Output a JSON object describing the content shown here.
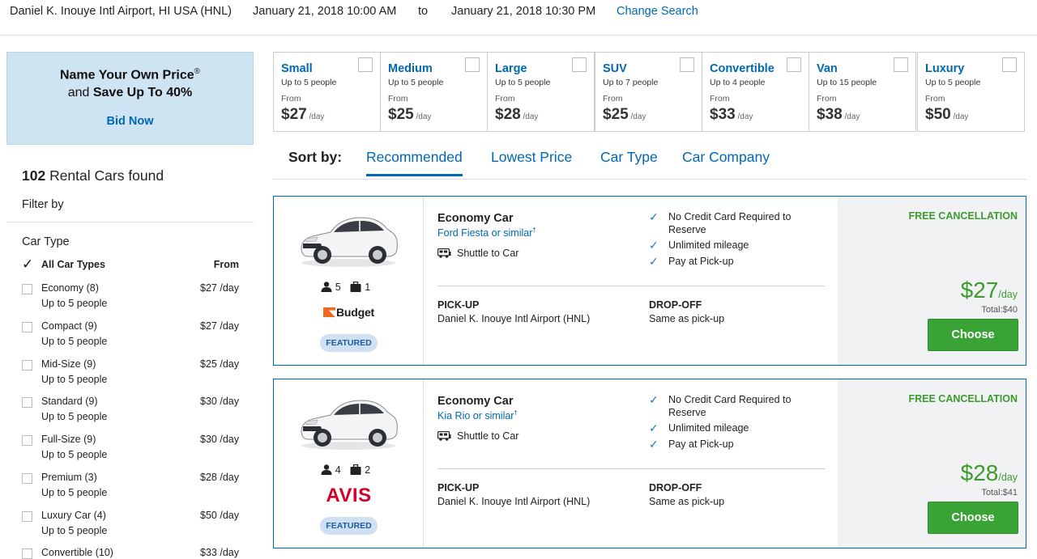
{
  "search": {
    "location": "Daniel K. Inouye Intl Airport, HI USA (HNL)",
    "pickup_datetime": "January 21, 2018 10:00 AM",
    "to_label": "to",
    "dropoff_datetime": "January 21, 2018 10:30 PM",
    "change_label": "Change Search"
  },
  "promo": {
    "line1": "Name Your Own Price",
    "reg": "®",
    "line2_prefix": "and ",
    "line2_bold": "Save Up To 40%",
    "button": "Bid Now"
  },
  "results_summary": {
    "count": "102",
    "label": " Rental Cars found",
    "filter_by": "Filter by"
  },
  "filters": {
    "title": "Car Type",
    "all_label": "All Car Types",
    "from_label": "From",
    "items": [
      {
        "name": "Economy (8)",
        "sub": "Up to 5 people",
        "price": "$27 /day"
      },
      {
        "name": "Compact (9)",
        "sub": "Up to 5 people",
        "price": "$27 /day"
      },
      {
        "name": "Mid-Size (9)",
        "sub": "Up to 5 people",
        "price": "$25 /day"
      },
      {
        "name": "Standard (9)",
        "sub": "Up to 5 people",
        "price": "$30 /day"
      },
      {
        "name": "Full-Size (9)",
        "sub": "Up to 5 people",
        "price": "$30 /day"
      },
      {
        "name": "Premium (3)",
        "sub": "Up to 5 people",
        "price": "$28 /day"
      },
      {
        "name": "Luxury Car (4)",
        "sub": "Up to 5 people",
        "price": "$50 /day"
      },
      {
        "name": "Convertible (10)",
        "sub": "",
        "price": "$33 /day"
      }
    ]
  },
  "car_types": [
    {
      "name": "Small",
      "sub": "Up to 5 people",
      "from": "From",
      "price": "$27",
      "per": " /day"
    },
    {
      "name": "Medium",
      "sub": "Up to 5 people",
      "from": "From",
      "price": "$25",
      "per": " /day"
    },
    {
      "name": "Large",
      "sub": "Up to 5 people",
      "from": "From",
      "price": "$28",
      "per": " /day"
    },
    {
      "name": "SUV",
      "sub": "Up to 7 people",
      "from": "From",
      "price": "$25",
      "per": " /day"
    },
    {
      "name": "Convertible",
      "sub": "Up to 4 people",
      "from": "From",
      "price": "$33",
      "per": " /day"
    },
    {
      "name": "Van",
      "sub": "Up to 15 people",
      "from": "From",
      "price": "$38",
      "per": " /day"
    },
    {
      "name": "Luxury",
      "sub": "Up to 5 people",
      "from": "From",
      "price": "$50",
      "per": " /day"
    }
  ],
  "sort": {
    "label": "Sort by:",
    "tabs": [
      "Recommended",
      "Lowest Price",
      "Car Type",
      "Car Company"
    ]
  },
  "results": [
    {
      "car_type": "Economy Car",
      "model": "Ford Fiesta or similar",
      "dagger": "†",
      "shuttle": "Shuttle to Car",
      "passengers": "5",
      "bags": "1",
      "company": "Budget",
      "badge": "FEATURED",
      "features": [
        "No Credit Card Required to Reserve",
        "Unlimited mileage",
        "Pay at Pick-up"
      ],
      "pickup_label": "PICK-UP",
      "pickup_value": "Daniel K. Inouye Intl Airport (HNL)",
      "dropoff_label": "DROP-OFF",
      "dropoff_value": "Same as pick-up",
      "cancellation": "FREE CANCELLATION",
      "price": "$27",
      "per": "/day",
      "total": "Total:$40",
      "choose": "Choose"
    },
    {
      "car_type": "Economy Car",
      "model": "Kia Rio or similar",
      "dagger": "†",
      "shuttle": "Shuttle to Car",
      "passengers": "4",
      "bags": "2",
      "company": "AVIS",
      "badge": "FEATURED",
      "features": [
        "No Credit Card Required to Reserve",
        "Unlimited mileage",
        "Pay at Pick-up"
      ],
      "pickup_label": "PICK-UP",
      "pickup_value": "Daniel K. Inouye Intl Airport (HNL)",
      "dropoff_label": "DROP-OFF",
      "dropoff_value": "Same as pick-up",
      "cancellation": "FREE CANCELLATION",
      "price": "$28",
      "per": "/day",
      "total": "Total:$41",
      "choose": "Choose"
    }
  ],
  "colors": {
    "link": "#0068b3",
    "price_green": "#3c9a2f",
    "button_green": "#3aa335",
    "promo_bg": "#cfe4f3"
  }
}
